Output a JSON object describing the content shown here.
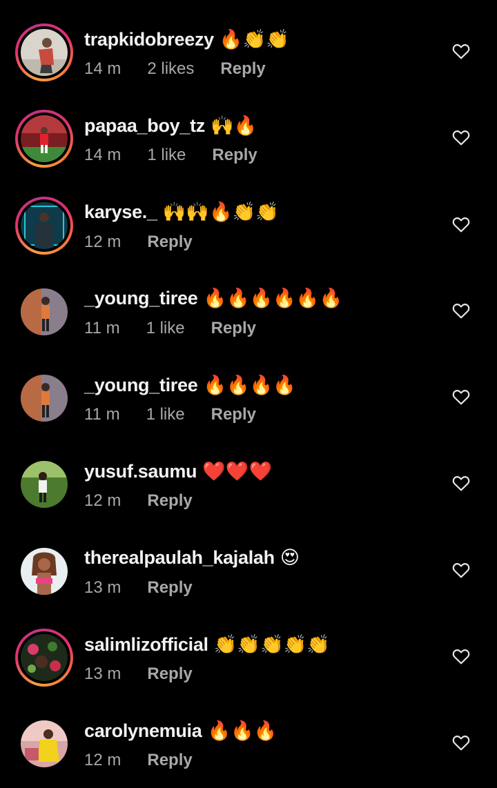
{
  "colors": {
    "background": "#000000",
    "username": "#f2f2f2",
    "meta": "#a8a8a8",
    "story_ring": "#e1306c"
  },
  "comments": [
    {
      "username": "trapkidobreezy",
      "emojis": "🔥👏👏",
      "time": "14 m",
      "likes": "2 likes",
      "reply": "Reply",
      "story_ring": true,
      "heart_icon": "heart-outline-icon"
    },
    {
      "username": "papaa_boy_tz",
      "emojis": "🙌🔥",
      "time": "14 m",
      "likes": "1 like",
      "reply": "Reply",
      "story_ring": true,
      "heart_icon": "heart-outline-icon"
    },
    {
      "username": "karyse._",
      "emojis": "🙌🙌🔥👏👏",
      "time": "12 m",
      "likes": "",
      "reply": "Reply",
      "story_ring": true,
      "heart_icon": "heart-outline-icon"
    },
    {
      "username": "_young_tiree",
      "emojis": "🔥🔥🔥🔥🔥🔥",
      "time": "11 m",
      "likes": "1 like",
      "reply": "Reply",
      "story_ring": false,
      "heart_icon": "heart-outline-icon"
    },
    {
      "username": "_young_tiree",
      "emojis": "🔥🔥🔥🔥",
      "time": "11 m",
      "likes": "1 like",
      "reply": "Reply",
      "story_ring": false,
      "heart_icon": "heart-outline-icon"
    },
    {
      "username": "yusuf.saumu",
      "emojis": "❤️❤️❤️",
      "time": "12 m",
      "likes": "",
      "reply": "Reply",
      "story_ring": false,
      "heart_icon": "heart-outline-icon"
    },
    {
      "username": "therealpaulah_kajalah",
      "emojis": "😍",
      "time": "13 m",
      "likes": "",
      "reply": "Reply",
      "story_ring": false,
      "heart_icon": "heart-outline-icon"
    },
    {
      "username": "salimlizofficial",
      "emojis": "👏👏👏👏👏",
      "time": "13 m",
      "likes": "",
      "reply": "Reply",
      "story_ring": true,
      "heart_icon": "heart-outline-icon"
    },
    {
      "username": "carolynemuia",
      "emojis": "🔥🔥🔥",
      "time": "12 m",
      "likes": "",
      "reply": "Reply",
      "story_ring": false,
      "heart_icon": "heart-outline-icon"
    }
  ]
}
